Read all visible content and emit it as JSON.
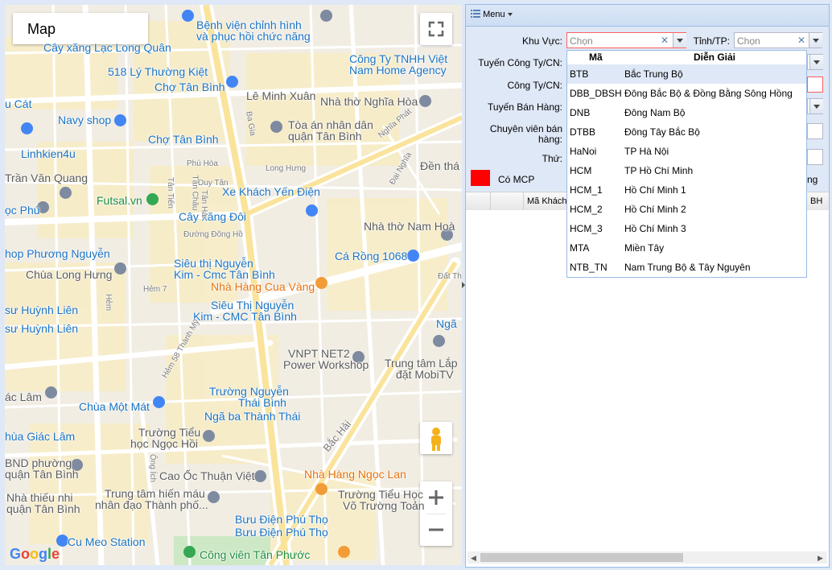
{
  "map": {
    "tab_label": "Map",
    "attribution": "Google",
    "places": [
      "Bệnh viện chỉnh hình",
      "và phục hồi chức năng",
      "Cây xăng Lạc Long Quân",
      "518 Lý Thường Kiệt",
      "Chợ Tân Bình",
      "Lê Minh Xuân",
      "Công Ty TNHH Việt",
      "Nam Home Agency",
      "u Cát",
      "Navy shop",
      "Nhà thờ Nghĩa Hòa",
      "Tòa án nhân dân",
      "quận Tân Bình",
      "Chợ Tân Bình",
      "Linhkien4u",
      "Trần Văn Quang",
      "Đền thá",
      "Futsal.vn",
      "Xe Khách Yến Điện",
      "ọc Phú",
      "Cây xăng Đôi",
      "Nhà thờ Nam Hoà",
      "hop Phương Nguyễn",
      "Siêu thị Nguyễn",
      "Kim - Cmc Tân Bình",
      "Cá Rồng 1068",
      "Chùa Long Hưng",
      "Nhà Hàng Cua Vàng",
      "sư Huỳnh Liên",
      "Siêu Thị Nguyễn",
      "Kim - CMC Tân Bình",
      "sư Huỳnh Liên",
      "Ngã",
      "VNPT NET2",
      "Power Workshop",
      "Trung tâm Lắp",
      "đặt MobiTV",
      "ác Lâm",
      "Trường Nguyễn",
      "Thái Bình",
      "Chùa Một Mát",
      "Ngã ba Thành Thái",
      "Trường Tiểu",
      "học Ngọc Hồi",
      "hùa Giác Lâm",
      "BND phường",
      "quận Tân Bình",
      "Cao Ốc Thuận Việt",
      "Nhà Hàng Ngọc Lan",
      "Nhà thiếu nhi",
      "quận Tân Bình",
      "Trung tâm hiến máu",
      "nhân đạo Thành phố...",
      "Trường Tiểu Học",
      "Võ Trường Toản",
      "Bưu Điện Phú Thọ",
      "Bưu Điện Phú Thọ",
      "Cu Meo Station",
      "Công viên Tân Phước"
    ],
    "streets": [
      "Ba Gia",
      "Nghĩa Phát",
      "Phú Hòa",
      "Duy Tân",
      "Long Hưng",
      "Đại Nghĩa",
      "Đường Đông Hồ",
      "Tân Tiến",
      "Tân Châu",
      "Tân Hải",
      "Hẻm 7",
      "Hẻm",
      "Hẻm 58 Thành Mỹ",
      "Bắc Hải",
      "Ông Ích",
      "Đất Thá"
    ]
  },
  "panel": {
    "menu_label": "Menu",
    "fields": {
      "khu_vuc_label": "Khu Vực:",
      "khu_vuc_placeholder": "Chọn",
      "tinh_tp_label": "Tỉnh/TP:",
      "tinh_tp_placeholder": "Chọn",
      "tuyen_cty_label": "Tuyến Công Ty/CN:",
      "cong_ty_label": "Công Ty/CN:",
      "tuyen_ban_hang_label": "Tuyến Bán Hàng:",
      "chuyen_vien_label_1": "Chuyên viên bán",
      "chuyen_vien_label_2": "hàng:",
      "thu_label": "Thứ:",
      "co_mcp_label": "Có MCP",
      "right_fragment": "ng"
    },
    "grid": {
      "columns": [
        "Mã Khách",
        "BH"
      ]
    },
    "legend_color": "#ff0000"
  },
  "dropdown": {
    "header_code": "Mã",
    "header_desc": "Diễn Giải",
    "rows": [
      {
        "code": "BTB",
        "desc": "Bắc Trung Bộ"
      },
      {
        "code": "DBB_DBSH",
        "desc": "Đông Bắc Bộ & Đồng Bằng Sông Hồng"
      },
      {
        "code": "DNB",
        "desc": "Đông Nam Bộ"
      },
      {
        "code": "DTBB",
        "desc": "Đông Tây Bắc Bộ"
      },
      {
        "code": "HaNoi",
        "desc": "TP Hà Nội"
      },
      {
        "code": "HCM",
        "desc": "TP Hồ Chí Minh"
      },
      {
        "code": "HCM_1",
        "desc": "Hồ Chí Minh 1"
      },
      {
        "code": "HCM_2",
        "desc": "Hồ Chí Minh 2"
      },
      {
        "code": "HCM_3",
        "desc": "Hồ Chí Minh 3"
      },
      {
        "code": "MTA",
        "desc": "Miền Tây"
      },
      {
        "code": "NTB_TN",
        "desc": "Nam Trung Bộ & Tây Nguyên"
      }
    ]
  }
}
